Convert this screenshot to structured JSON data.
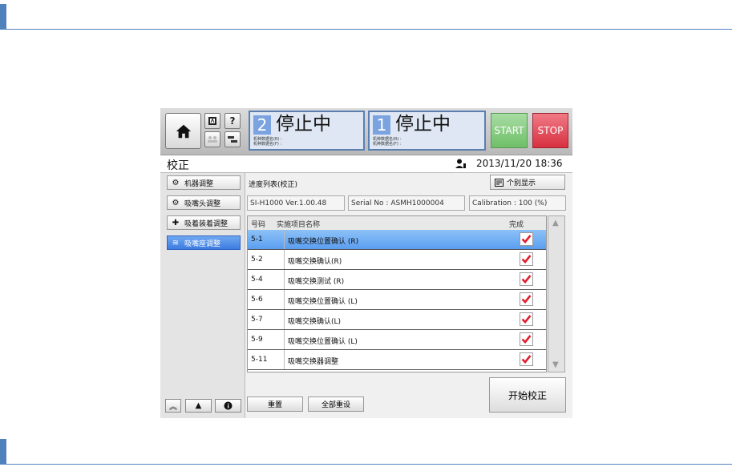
{
  "header": {
    "status_left": {
      "num": "2",
      "text": "停止中",
      "sub1": "机种数据名(R) :",
      "sub2": "机种数据名(F) :"
    },
    "status_right": {
      "num": "1",
      "text": "停止中",
      "sub1": "机种数据名(R) :",
      "sub2": "机种数据名(F) :"
    },
    "start_label": "START",
    "stop_label": "STOP",
    "help_label": "?"
  },
  "titlebar": {
    "title": "校正",
    "datetime": "2013/11/20 18:36"
  },
  "sidebar": {
    "items": [
      {
        "label": "机器调整",
        "active": false
      },
      {
        "label": "吸嘴头调整",
        "active": false
      },
      {
        "label": "吸着装着调整",
        "active": false
      },
      {
        "label": "吸嘴座调整",
        "active": true
      }
    ]
  },
  "main": {
    "list_title": "进度列表(校正)",
    "individual_button": "个别显示",
    "version": "SI-H1000 Ver.1.00.48",
    "serial": "Serial No : ASMH1000004",
    "calibration": "Calibration : 100 (%)",
    "table": {
      "headers": [
        "号码",
        "实施项目名称",
        "完成"
      ],
      "rows": [
        {
          "num": "5-1",
          "name": "吸嘴交换位置确认 (R)",
          "done": true
        },
        {
          "num": "5-2",
          "name": "吸嘴交换确认(R)",
          "done": true
        },
        {
          "num": "5-4",
          "name": "吸嘴交换测试 (R)",
          "done": true
        },
        {
          "num": "5-6",
          "name": "吸嘴交换位置确认 (L)",
          "done": true
        },
        {
          "num": "5-7",
          "name": "吸嘴交换确认(L)",
          "done": true
        },
        {
          "num": "5-9",
          "name": "吸嘴交换位置确认 (L)",
          "done": true
        },
        {
          "num": "5-11",
          "name": "吸嘴交换器调整",
          "done": true
        }
      ]
    },
    "reset_button": "重置",
    "reset_all_button": "全部重设",
    "start_calibration_button": "开始校正"
  },
  "colors": {
    "accent": "#4f81bd",
    "selected_row": "#5a9ef0",
    "check": "#e02030",
    "start": "#6fbf68",
    "stop": "#d8303f"
  }
}
